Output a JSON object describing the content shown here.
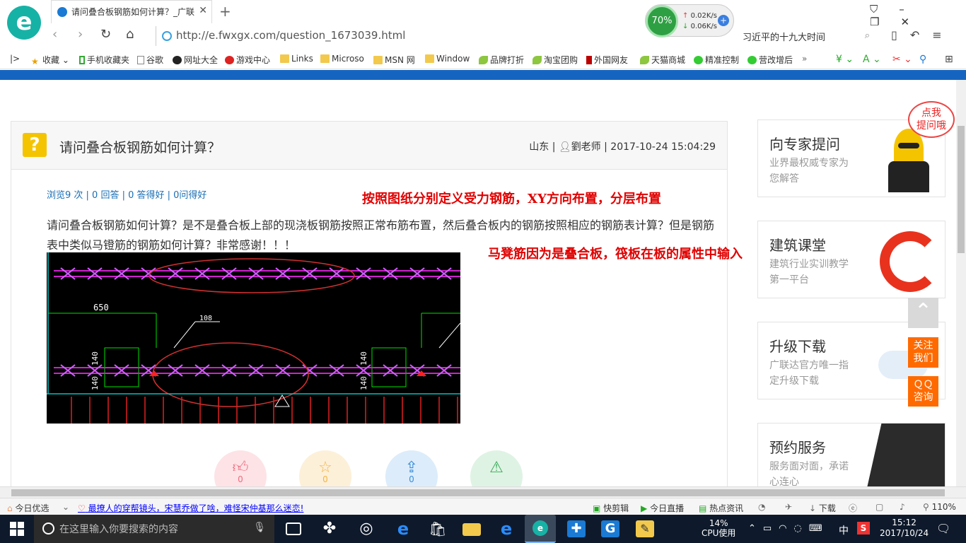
{
  "browser": {
    "tab_title": "请问叠合板钢筋如何计算？_广联",
    "url": "http://e.fwxgx.com/question_1673039.html",
    "speed_percent": "70%",
    "speed_up": "0.02K/s",
    "speed_down": "0.06K/s",
    "search_text": "习近平的十九大时间"
  },
  "bookmarks": [
    {
      "label": "收藏",
      "icon": "star-icon"
    },
    {
      "label": "手机收藏夹",
      "icon": "phone-icon"
    },
    {
      "label": "谷歌",
      "icon": "page-icon"
    },
    {
      "label": "网址大全",
      "icon": "globe-icon"
    },
    {
      "label": "游戏中心",
      "icon": "game-icon"
    },
    {
      "label": "Links",
      "icon": "folder-icon"
    },
    {
      "label": "Microso",
      "icon": "folder-icon"
    },
    {
      "label": "MSN 网",
      "icon": "folder-icon"
    },
    {
      "label": "Window",
      "icon": "folder-icon"
    },
    {
      "label": "品牌打折",
      "icon": "leaf-icon"
    },
    {
      "label": "淘宝团购",
      "icon": "leaf-icon"
    },
    {
      "label": "外国网友",
      "icon": "page-icon"
    },
    {
      "label": "天猫商城",
      "icon": "leaf-icon"
    },
    {
      "label": "精准控制",
      "icon": "chat-icon"
    },
    {
      "label": "营改增后",
      "icon": "chat-icon"
    }
  ],
  "question": {
    "icon_glyph": "?",
    "title": "请问叠合板钢筋如何计算？",
    "meta_location": "山东 |",
    "meta_author": "劉老师",
    "meta_time": "| 2017-10-24 15:04:29",
    "stats": "浏览9 次 | 0 回答 | 0 答得好 | 0问得好",
    "body": "请问叠合板钢筋如何计算？是不是叠合板上部的现浇板钢筋按照正常布筋布置，然后叠合板内的钢筋按照相应的钢筋表计算？但是钢筋表中类似马镫筋的钢筋如何计算？非常感谢！！！"
  },
  "cad": {
    "dim_650": "650",
    "dim_108": "108",
    "dim_140a": "140",
    "dim_140b": "140",
    "dim_140c": "140",
    "dim_140d": "140"
  },
  "annotations": {
    "line1": "按照图纸分别定义受力钢筋，XY方向布置，分层布置",
    "line2": "马凳筋因为是叠合板，筏板在板的属性中输入"
  },
  "actions": {
    "like_count": "0",
    "star_count": "0",
    "share_count": "0"
  },
  "sidebar": {
    "ask_bubble": "点我\n提问哦",
    "cards": [
      {
        "title": "向专家提问",
        "sub": "业界最权威专家为您解答"
      },
      {
        "title": "建筑课堂",
        "sub": "建筑行业实训教学第一平台"
      },
      {
        "title": "升级下载",
        "sub": "广联达官方唯一指定升级下载"
      },
      {
        "title": "预约服务",
        "sub": "服务面对面，承诺心连心"
      }
    ],
    "follow_us": "关注我们",
    "qq_consult": "QQ咨询"
  },
  "statusbar": {
    "today_pick": "今日优选",
    "news": "最撩人的穿帮镜头，宋慧乔做了啥，难怪宋仲基那么迷恋!",
    "quick_clip": "快剪辑",
    "today_live": "今日直播",
    "hot_news": "热点资讯",
    "download": "下载",
    "zoom": "110%"
  },
  "taskbar": {
    "search_placeholder": "在这里输入你要搜索的内容",
    "cpu_percent": "14%",
    "cpu_label": "CPU使用",
    "ime": "中",
    "time": "15:12",
    "date": "2017/10/24"
  },
  "colors": {
    "accent_blue": "#1565c0",
    "annotation_red": "#e00000",
    "orange": "#ff6a00"
  }
}
